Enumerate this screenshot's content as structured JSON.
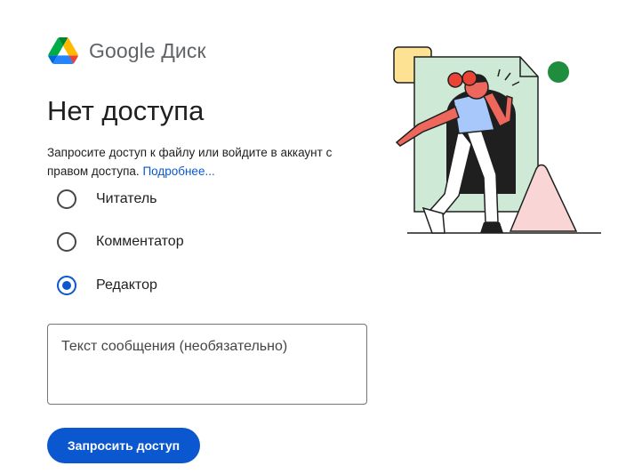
{
  "brand": {
    "name": "Google Диск",
    "icon": "google-drive-icon"
  },
  "title": "Нет доступа",
  "description": {
    "text": "Запросите доступ к файлу или войдите в аккаунт с правом доступа. ",
    "link": "Подробнее..."
  },
  "roles": [
    {
      "label": "Читатель",
      "checked": false
    },
    {
      "label": "Комментатор",
      "checked": false
    },
    {
      "label": "Редактор",
      "checked": true
    }
  ],
  "message": {
    "placeholder": "Текст сообщения (необязательно)",
    "value": ""
  },
  "request_button": {
    "label": "Запросить доступ"
  },
  "colors": {
    "accent": "#0b57d0",
    "illustration_bg": "#ceead6",
    "green_dot": "#1e8e3e"
  },
  "illustration": "person-walking-through-document-illustration"
}
